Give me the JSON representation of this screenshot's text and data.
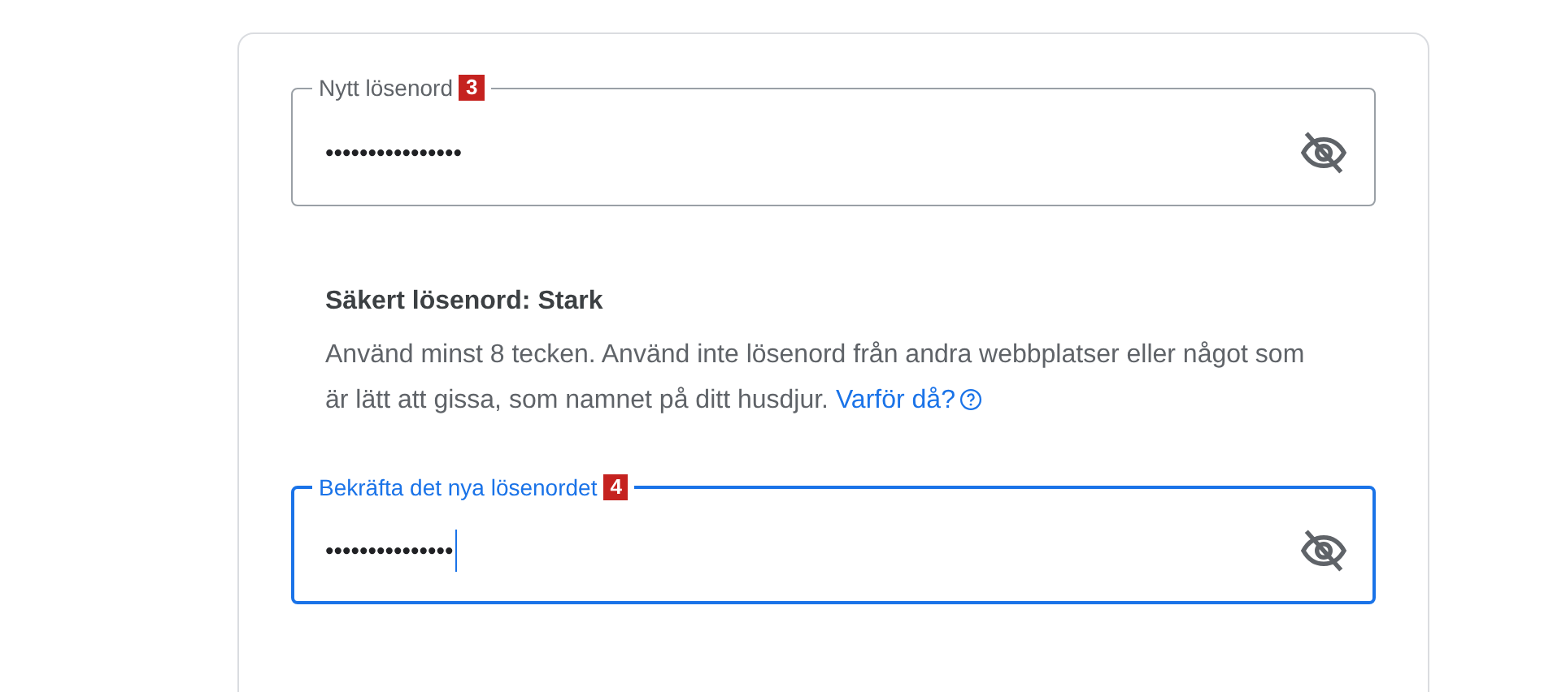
{
  "fields": [
    {
      "label": "Nytt lösenord",
      "badge": "3",
      "value": "••••••••••••••••",
      "focused": false
    },
    {
      "label": "Bekräfta det nya lösenordet",
      "badge": "4",
      "value": "•••••••••••••••",
      "focused": true
    }
  ],
  "strength": {
    "title": "Säkert lösenord: Stark",
    "text": "Använd minst 8 tecken. Använd inte lösenord från andra webbplatser eller något som är lätt att gissa, som namnet på ditt husdjur.",
    "link": "Varför då?"
  }
}
